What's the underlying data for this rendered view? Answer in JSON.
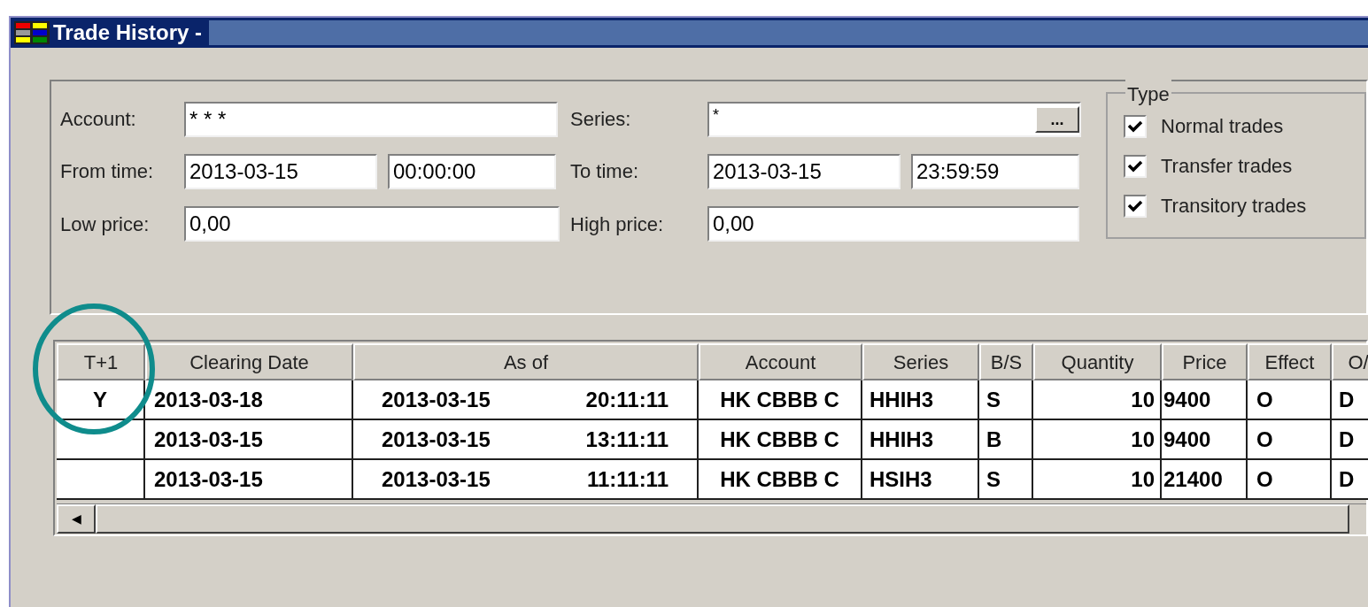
{
  "window": {
    "title": "Trade History -"
  },
  "filters": {
    "account": {
      "label": "Account:",
      "value": "* * *"
    },
    "series": {
      "label": "Series:",
      "value": "*",
      "browse": "..."
    },
    "from_time": {
      "label": "From time:",
      "date": "2013-03-15",
      "time": "00:00:00"
    },
    "to_time": {
      "label": "To time:",
      "date": "2013-03-15",
      "time": "23:59:59"
    },
    "low_price": {
      "label": "Low price:",
      "value": "0,00"
    },
    "high_price": {
      "label": "High price:",
      "value": "0,00"
    }
  },
  "type_group": {
    "title": "Type",
    "options": [
      {
        "label": "Normal trades",
        "checked": true
      },
      {
        "label": "Transfer trades",
        "checked": true
      },
      {
        "label": "Transitory trades",
        "checked": true
      }
    ]
  },
  "table": {
    "columns": [
      "T+1",
      "Clearing Date",
      "As of",
      "Account",
      "Series",
      "B/S",
      "Quantity",
      "Price",
      "Effect",
      "O/"
    ],
    "rows": [
      {
        "t_plus_1": "Y",
        "clearing_date": "2013-03-18",
        "as_of_date": "2013-03-15",
        "as_of_time": "20:11:11",
        "account": "HK CBBB C",
        "series": "HHIH3",
        "bs": "S",
        "quantity": "10",
        "price": "9400",
        "effect": "O",
        "column_10": "D"
      },
      {
        "clearing_date": "2013-03-15",
        "as_of_date": "2013-03-15",
        "as_of_time": "13:11:11",
        "account": "HK CBBB C",
        "series": "HHIH3",
        "bs": "B",
        "quantity": "10",
        "price": "9400",
        "effect": "O",
        "column_10": "D"
      },
      {
        "clearing_date": "2013-03-15",
        "as_of_date": "2013-03-15",
        "as_of_time": "11:11:11",
        "account": "HK CBBB C",
        "series": "HSIH3",
        "bs": "S",
        "quantity": "10",
        "price": "21400",
        "effect": "O",
        "column_10": "D"
      }
    ],
    "scroll_left": "◀"
  },
  "annotation": {
    "kind": "circle",
    "color": "#0f8c8c"
  }
}
